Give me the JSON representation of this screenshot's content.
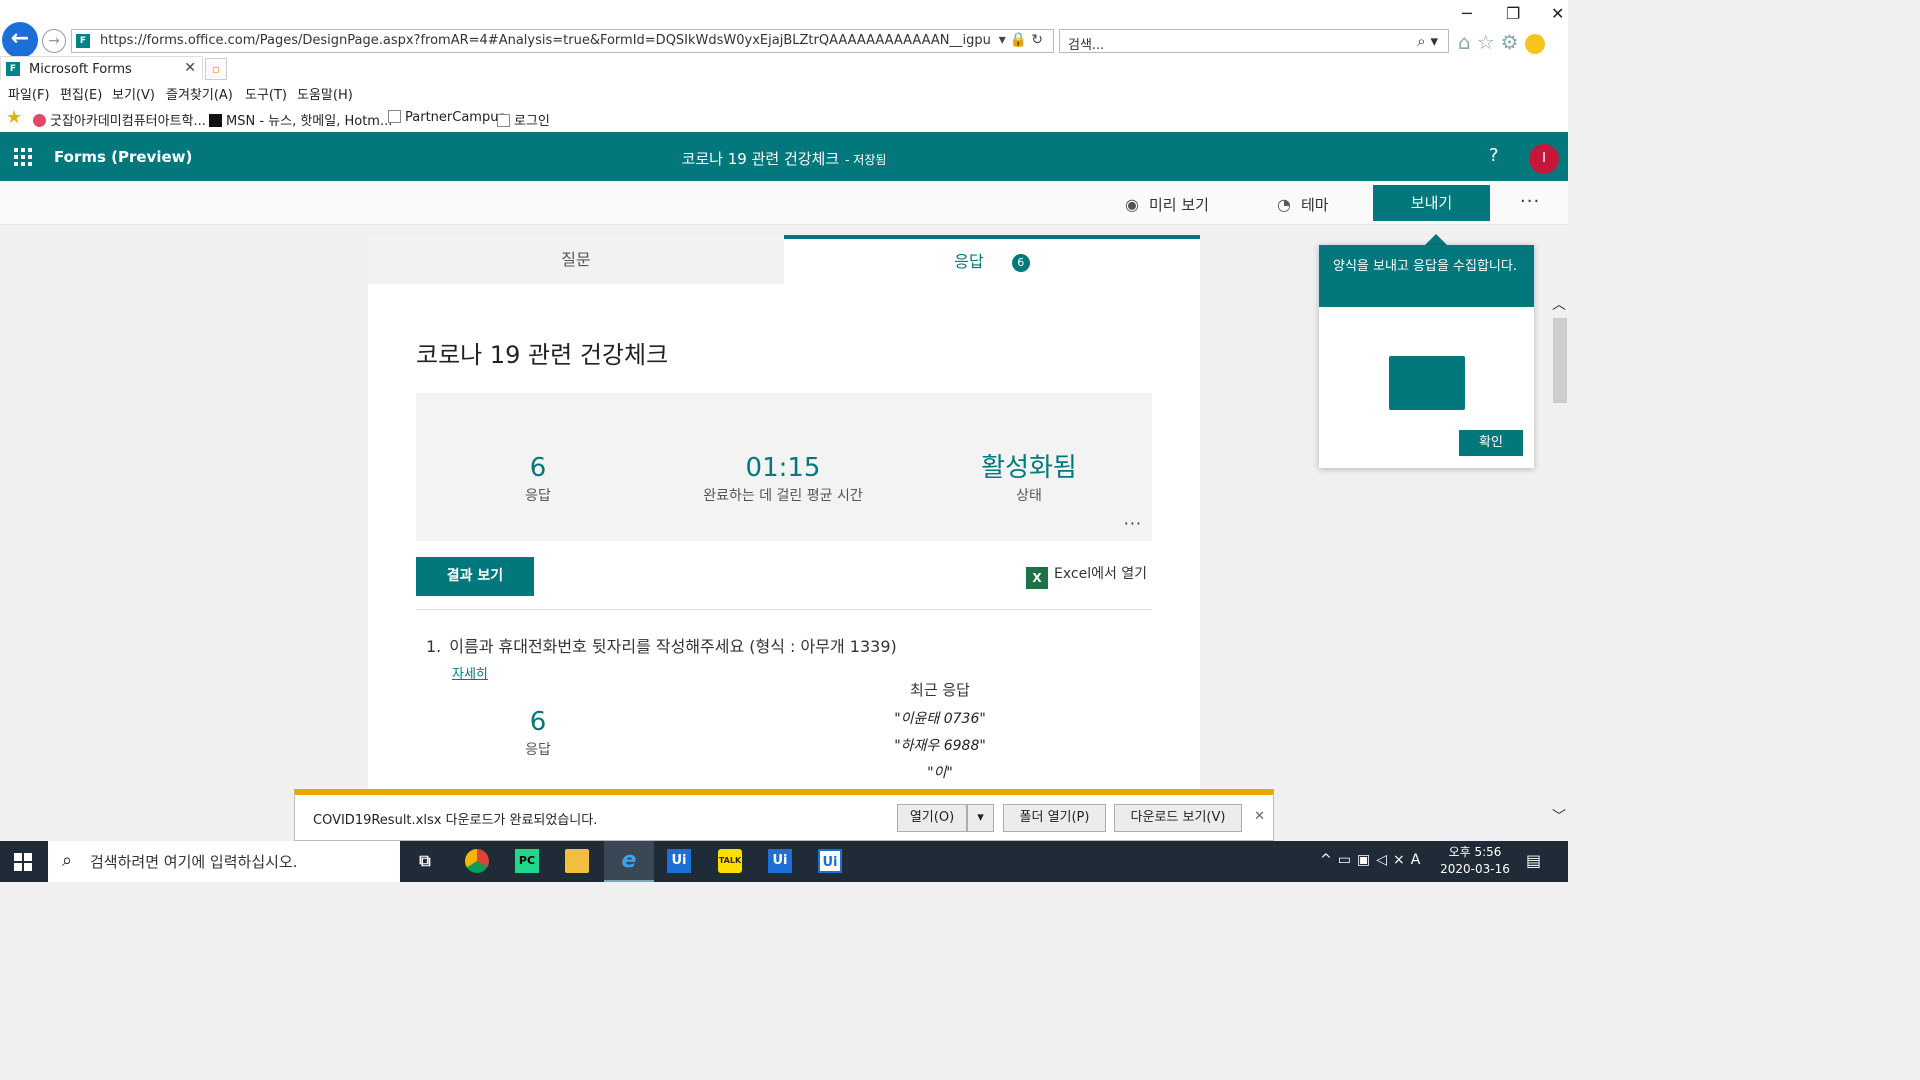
{
  "browser": {
    "url": "https://forms.office.com/Pages/DesignPage.aspx?fromAR=4#Analysis=true&FormId=DQSIkWdsW0yxEjajBLZtrQAAAAAAAAAAAAN__igpuCNURUhEUjNDSFNYTUI",
    "search_placeholder": "검색...",
    "tab_title": "Microsoft Forms",
    "menu": [
      "파일(F)",
      "편집(E)",
      "보기(V)",
      "즐겨찾기(A)",
      "도구(T)",
      "도움말(H)"
    ],
    "favorites": [
      "굿잡아카데미컴퓨터아트학...",
      "MSN - 뉴스, 핫메일, Hotm...",
      "PartnerCampus",
      "로그인"
    ]
  },
  "forms_header": {
    "app_name": "Forms (Preview)",
    "form_title": "코로나 19 관련 건강체크",
    "saved_status": "- 저장됨",
    "help": "?",
    "avatar_initial": "I"
  },
  "command_bar": {
    "preview": "미리 보기",
    "theme": "테마",
    "send": "보내기",
    "more": "···"
  },
  "card": {
    "tabs": {
      "questions": "질문",
      "responses": "응답",
      "response_count": "6"
    },
    "title": "코로나 19 관련 건강체크",
    "stats": [
      {
        "value": "6",
        "label": "응답"
      },
      {
        "value": "01:15",
        "label": "완료하는 데 걸린 평균 시간"
      },
      {
        "value": "활성화됨",
        "label": "상태"
      }
    ],
    "stats_more": "···",
    "view_results": "결과 보기",
    "open_in_excel": "Excel에서 열기",
    "question": {
      "number": "1.",
      "text": "이름과 휴대전화번호 뒷자리를 작성해주세요 (형식 : 아무개 1339)",
      "details": "자세히",
      "count_value": "6",
      "count_label": "응답",
      "recent_title": "최근 응답",
      "recent": [
        "\"이윤태 0736\"",
        "\"하재우 6988\"",
        "\"이\""
      ]
    }
  },
  "callout": {
    "message": "양식을 보내고 응답을 수집합니다.",
    "confirm": "확인"
  },
  "download_bar": {
    "message": "COVID19Result.xlsx 다운로드가 완료되었습니다.",
    "open": "열기(O)",
    "open_folder": "폴더 열기(P)",
    "view_downloads": "다운로드 보기(V)"
  },
  "taskbar": {
    "search_placeholder": "검색하려면 여기에 입력하십시오.",
    "time": "오후 5:56",
    "date": "2020-03-16",
    "ime": "A"
  },
  "colors": {
    "accent": "#03787c",
    "download_bar": "#e8a800",
    "avatar": "#c4173a"
  }
}
